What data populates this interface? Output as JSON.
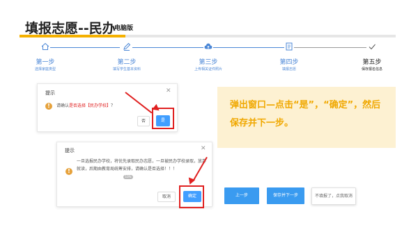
{
  "header": {
    "title": "填报志愿--民办",
    "subtitle": "电脑版",
    "colors": {
      "accent": "#f5b100",
      "primary": "#409eff",
      "warn": "#e6a23c",
      "highlight": "#e02020"
    }
  },
  "steps": [
    {
      "title": "第一步",
      "desc": "选择家庭类型",
      "icon": "home-icon"
    },
    {
      "title": "第二步",
      "desc": "填写学生基本资料",
      "icon": "edit-icon"
    },
    {
      "title": "第三步",
      "desc": "上传相关证件照片",
      "icon": "upload-icon"
    },
    {
      "title": "第四步",
      "desc": "填报志愿",
      "icon": "document-icon"
    },
    {
      "title": "第五步",
      "desc": "保存报名信息",
      "icon": "check-icon"
    }
  ],
  "dialog1": {
    "title": "提示",
    "message_prefix": "请确认",
    "message_highlight": "是否选择【民办学校】",
    "message_suffix": "？",
    "no_label": "否",
    "yes_label": "是"
  },
  "dialog2": {
    "title": "提示",
    "message": "一旦选报民办学校，将优先录取民办志愿，一旦被民办学校录取，放弃就读，后期由教育局统筹安排，请确认是否选择！！！",
    "badge": "10%",
    "cancel_label": "取消",
    "confirm_label": "确定"
  },
  "note": {
    "text": "弹出窗口—点击“是”，“确定”，然后保存并下一步。"
  },
  "actions": {
    "prev_label": "上一步",
    "save_next_label": "保存并下一步",
    "cancel_label": "不填报了，点我取消"
  }
}
